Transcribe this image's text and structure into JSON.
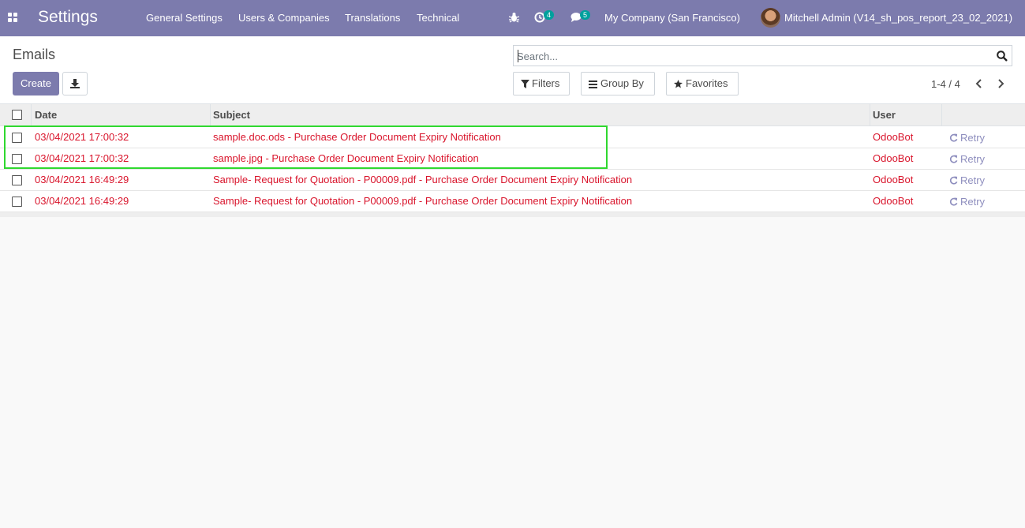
{
  "navbar": {
    "app_title": "Settings",
    "menus": [
      "General Settings",
      "Users & Companies",
      "Translations",
      "Technical"
    ],
    "activity_badge": "4",
    "messages_badge": "5",
    "company": "My Company (San Francisco)",
    "user": "Mitchell Admin (V14_sh_pos_report_23_02_2021)"
  },
  "control": {
    "title": "Emails",
    "create_label": "Create",
    "search_placeholder": "Search...",
    "filters_label": "Filters",
    "groupby_label": "Group By",
    "favorites_label": "Favorites",
    "pager": "1-4 / 4"
  },
  "table": {
    "headers": {
      "date": "Date",
      "subject": "Subject",
      "user": "User"
    },
    "retry_label": "Retry",
    "rows": [
      {
        "date": "03/04/2021 17:00:32",
        "subject": "sample.doc.ods - Purchase Order Document Expiry Notification",
        "user": "OdooBot"
      },
      {
        "date": "03/04/2021 17:00:32",
        "subject": "sample.jpg - Purchase Order Document Expiry Notification",
        "user": "OdooBot"
      },
      {
        "date": "03/04/2021 16:49:29",
        "subject": "Sample- Request for Quotation - P00009.pdf - Purchase Order Document Expiry Notification",
        "user": "OdooBot"
      },
      {
        "date": "03/04/2021 16:49:29",
        "subject": "Sample- Request for Quotation - P00009.pdf - Purchase Order Document Expiry Notification",
        "user": "OdooBot"
      }
    ]
  },
  "colors": {
    "navbar": "#7c7bad",
    "row_text": "#d9152c",
    "retry": "#8e8ebe",
    "highlight": "#2fd82f"
  }
}
